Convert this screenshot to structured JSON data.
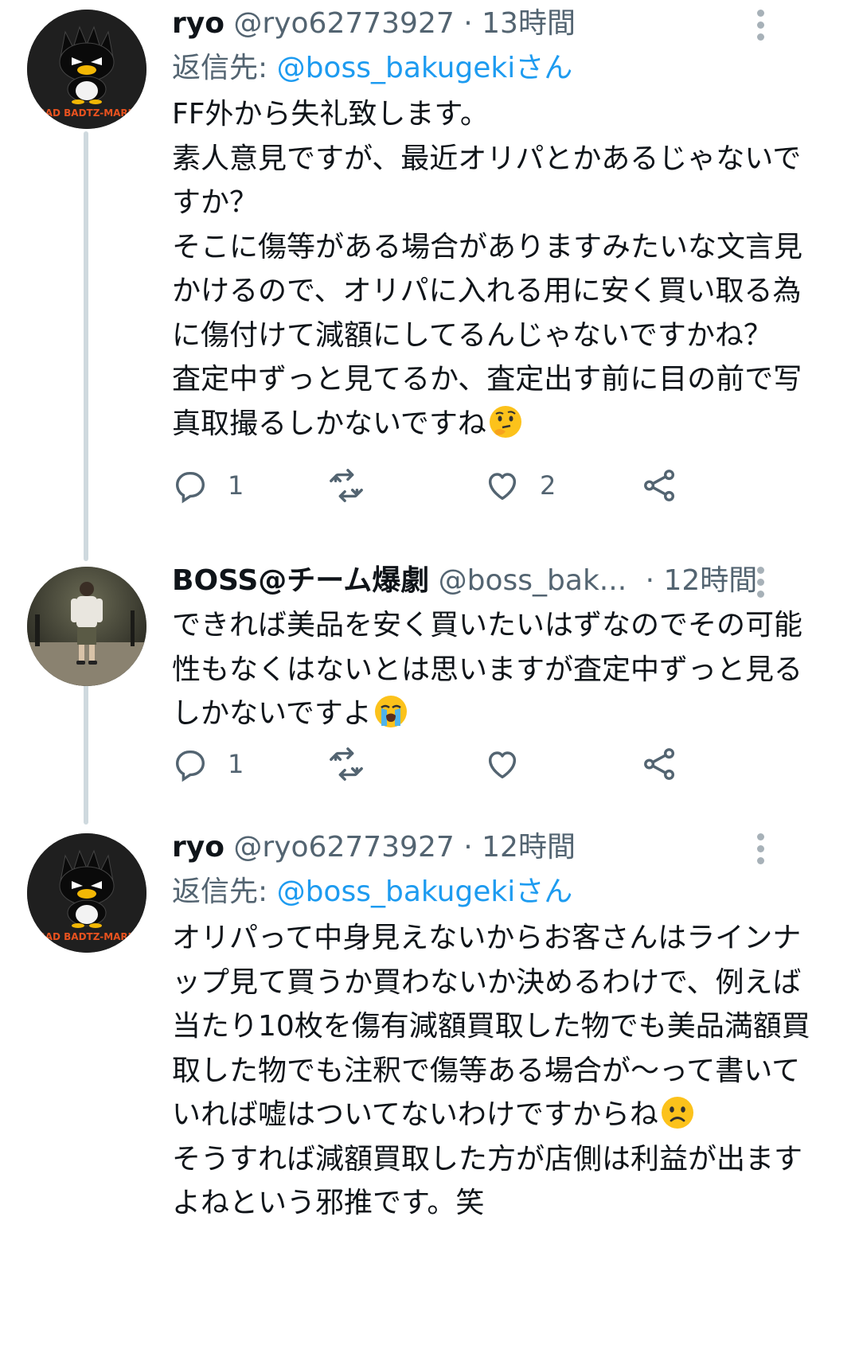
{
  "tweets": [
    {
      "name": "ryo",
      "handle": "@ryo62773927",
      "time": "13時間",
      "reply_prefix": "返信先: ",
      "reply_to": "@boss_bakugekiさん",
      "avatar_label": "BAD BADTZ-MARU",
      "text": [
        "FF外から失礼致します。",
        "素人意見ですが、最近オリパとかあるじゃないですか？",
        "そこに傷等がある場合がありますみたいな文言見かけるので、オリパに入れる用に安く買い取る為に傷付けて減額にしてるんじゃないですかね？",
        "査定中ずっと見てるか、査定出す前に目の前で写真取撮るしかないですね"
      ],
      "emoji": "thinking-face",
      "reply_count": "1",
      "retweet_count": "",
      "like_count": "2"
    },
    {
      "name": "BOSS@チーム爆劇",
      "handle": "@boss_bak...",
      "time": "12時間",
      "avatar_label": "",
      "text": [
        "できれば美品を安く買いたいはずなのでその可能性もなくはないとは思いますが査定中ずっと見るしかないですよ"
      ],
      "emoji": "loudly-crying-face",
      "reply_count": "1",
      "retweet_count": "",
      "like_count": ""
    },
    {
      "name": "ryo",
      "handle": "@ryo62773927",
      "time": "12時間",
      "reply_prefix": "返信先: ",
      "reply_to": "@boss_bakugekiさん",
      "avatar_label": "BAD BADTZ-MARU",
      "text": [
        "オリパって中身見えないからお客さんはラインナップ見て買うか買わないか決めるわけで、例えば当たり10枚を傷有減額買取した物でも美品満額買取した物でも注釈で傷等ある場合が〜って書いていれば嘘はついてないわけですからね",
        "そうすれば減額買取した方が店側は利益が出ますよねという邪推です。笑"
      ],
      "emoji": "frowning-face",
      "reply_count": "",
      "retweet_count": "",
      "like_count": ""
    }
  ],
  "colors": {
    "name": "#0f1419",
    "secondary": "#536471",
    "link": "#1d9bf0",
    "thread_line": "#cfd9de",
    "background": "#ffffff"
  },
  "icons": [
    "more-vertical-icon",
    "reply-icon",
    "retweet-icon",
    "like-icon",
    "share-icon"
  ]
}
